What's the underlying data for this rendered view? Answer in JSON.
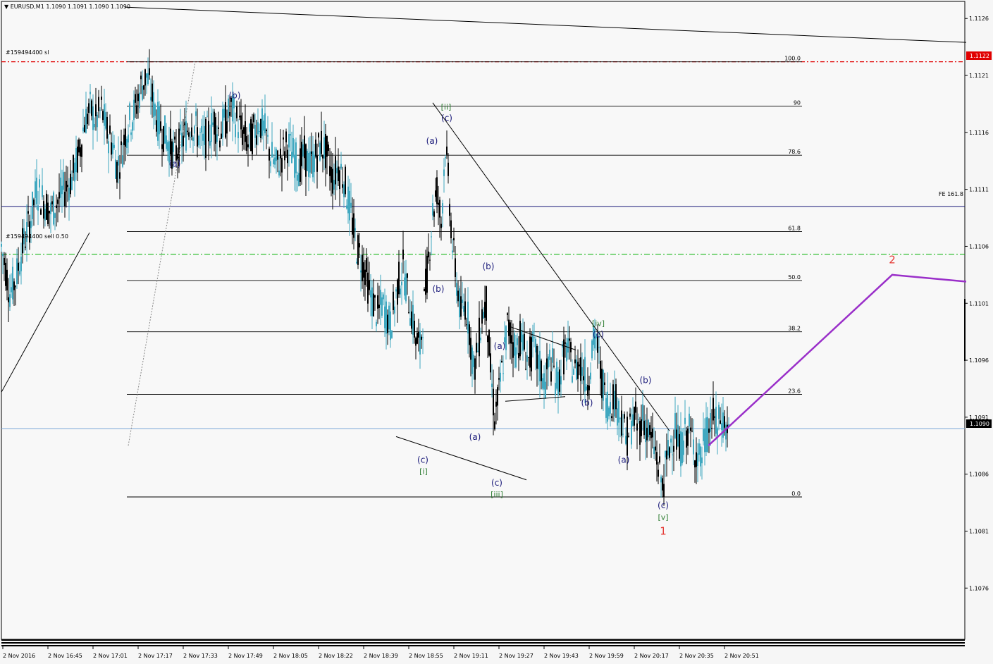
{
  "header": {
    "symbol_text": "EURUSD,M1  1.1090 1.1091 1.1090 1.1090"
  },
  "order_labels": {
    "sl_label": "#159494400 sl",
    "sell_label": "#159494400 sell 0.50"
  },
  "price_tags": {
    "red_tag": "1.1122",
    "current_tag": "1.1090"
  },
  "fe_label": "FE 161.8",
  "colors": {
    "background": "#f6f6f6",
    "bull": "#40a8c0",
    "bear": "#000000",
    "sl_line": "#e00000",
    "sell_line": "#00b000",
    "current_line": "#7da7d9",
    "projection": "#9a2fc9",
    "red_tag_bg": "#e00000",
    "wave_blue": "#1a1a7a",
    "wave_green": "#2e7d32",
    "wave_red": "#e53935"
  },
  "chart_data": {
    "type": "candlestick",
    "symbol": "EURUSD",
    "timeframe": "M1",
    "ylim": [
      1.10715,
      1.11275
    ],
    "y_ticks": [
      "1.1126",
      "1.1121",
      "1.1116",
      "1.1111",
      "1.1106",
      "1.1101",
      "1.1096",
      "1.1091",
      "1.1086",
      "1.1081",
      "1.1076"
    ],
    "x_ticks": [
      "2 Nov 2016",
      "2 Nov 16:45",
      "2 Nov 17:01",
      "2 Nov 17:17",
      "2 Nov 17:33",
      "2 Nov 17:49",
      "2 Nov 18:05",
      "2 Nov 18:22",
      "2 Nov 18:39",
      "2 Nov 18:55",
      "2 Nov 19:11",
      "2 Nov 19:27",
      "2 Nov 19:43",
      "2 Nov 19:59",
      "2 Nov 20:17",
      "2 Nov 20:35",
      "2 Nov 20:51"
    ],
    "price_path": [
      [
        0,
        1.1106
      ],
      [
        6,
        1.1104
      ],
      [
        12,
        1.1102
      ],
      [
        20,
        1.1103
      ],
      [
        30,
        1.1106
      ],
      [
        40,
        1.1108
      ],
      [
        50,
        1.1111
      ],
      [
        60,
        1.111
      ],
      [
        70,
        1.1109
      ],
      [
        80,
        1.111
      ],
      [
        90,
        1.1111
      ],
      [
        100,
        1.1112
      ],
      [
        110,
        1.1114
      ],
      [
        118,
        1.1117
      ],
      [
        126,
        1.1118
      ],
      [
        134,
        1.1117
      ],
      [
        142,
        1.1118
      ],
      [
        150,
        1.1116
      ],
      [
        158,
        1.1115
      ],
      [
        164,
        1.1113
      ],
      [
        170,
        1.1114
      ],
      [
        176,
        1.1116
      ],
      [
        182,
        1.1117
      ],
      [
        190,
        1.1118
      ],
      [
        198,
        1.112
      ],
      [
        206,
        1.1121
      ],
      [
        214,
        1.1119
      ],
      [
        222,
        1.1117
      ],
      [
        230,
        1.1116
      ],
      [
        238,
        1.1115
      ],
      [
        246,
        1.1114
      ],
      [
        254,
        1.1115
      ],
      [
        262,
        1.1116
      ],
      [
        270,
        1.1117
      ],
      [
        278,
        1.1116
      ],
      [
        286,
        1.1115
      ],
      [
        294,
        1.1116
      ],
      [
        302,
        1.1117
      ],
      [
        310,
        1.1116
      ],
      [
        318,
        1.1117
      ],
      [
        326,
        1.1118
      ],
      [
        334,
        1.1117
      ],
      [
        342,
        1.1116
      ],
      [
        350,
        1.1115
      ],
      [
        358,
        1.1116
      ],
      [
        366,
        1.1117
      ],
      [
        374,
        1.1116
      ],
      [
        382,
        1.1114
      ],
      [
        390,
        1.1113
      ],
      [
        398,
        1.1114
      ],
      [
        406,
        1.1115
      ],
      [
        414,
        1.1114
      ],
      [
        422,
        1.1113
      ],
      [
        430,
        1.1114
      ],
      [
        438,
        1.1113
      ],
      [
        446,
        1.1114
      ],
      [
        454,
        1.1115
      ],
      [
        462,
        1.1114
      ],
      [
        470,
        1.1112
      ],
      [
        478,
        1.1113
      ],
      [
        486,
        1.1112
      ],
      [
        492,
        1.111
      ],
      [
        498,
        1.1108
      ],
      [
        504,
        1.1106
      ],
      [
        510,
        1.1105
      ],
      [
        516,
        1.1104
      ],
      [
        522,
        1.1102
      ],
      [
        528,
        1.1101
      ],
      [
        534,
        1.11
      ],
      [
        540,
        1.1101
      ],
      [
        546,
        1.11
      ],
      [
        552,
        1.1099
      ],
      [
        558,
        1.1101
      ],
      [
        564,
        1.1103
      ],
      [
        570,
        1.1104
      ],
      [
        576,
        1.1102
      ],
      [
        582,
        1.11
      ],
      [
        588,
        1.1098
      ],
      [
        594,
        1.1097
      ],
      [
        600,
        1.1101
      ],
      [
        606,
        1.1105
      ],
      [
        612,
        1.1109
      ],
      [
        618,
        1.1111
      ],
      [
        624,
        1.1108
      ],
      [
        630,
        1.1115
      ],
      [
        636,
        1.111
      ],
      [
        640,
        1.1106
      ],
      [
        646,
        1.1103
      ],
      [
        652,
        1.11
      ],
      [
        658,
        1.1101
      ],
      [
        664,
        1.1099
      ],
      [
        670,
        1.1095
      ],
      [
        676,
        1.1097
      ],
      [
        682,
        1.11
      ],
      [
        688,
        1.1101
      ],
      [
        694,
        1.1095
      ],
      [
        700,
        1.1091
      ],
      [
        706,
        1.1093
      ],
      [
        712,
        1.1096
      ],
      [
        718,
        1.1099
      ],
      [
        724,
        1.1098
      ],
      [
        730,
        1.1097
      ],
      [
        736,
        1.1098
      ],
      [
        742,
        1.1097
      ],
      [
        748,
        1.1096
      ],
      [
        754,
        1.1097
      ],
      [
        760,
        1.1096
      ],
      [
        766,
        1.1095
      ],
      [
        772,
        1.1094
      ],
      [
        778,
        1.1096
      ],
      [
        784,
        1.1095
      ],
      [
        790,
        1.1094
      ],
      [
        796,
        1.1096
      ],
      [
        802,
        1.1097
      ],
      [
        808,
        1.1096
      ],
      [
        814,
        1.1095
      ],
      [
        820,
        1.1096
      ],
      [
        826,
        1.1095
      ],
      [
        832,
        1.1094
      ],
      [
        838,
        1.1097
      ],
      [
        844,
        1.1098
      ],
      [
        850,
        1.1095
      ],
      [
        856,
        1.1093
      ],
      [
        862,
        1.1092
      ],
      [
        868,
        1.1093
      ],
      [
        874,
        1.1092
      ],
      [
        880,
        1.1091
      ],
      [
        886,
        1.1089
      ],
      [
        892,
        1.109
      ],
      [
        898,
        1.1091
      ],
      [
        904,
        1.109
      ],
      [
        910,
        1.1091
      ],
      [
        916,
        1.109
      ],
      [
        922,
        1.1089
      ],
      [
        928,
        1.1088
      ],
      [
        934,
        1.1086
      ],
      [
        938,
        1.1085
      ],
      [
        944,
        1.1087
      ],
      [
        950,
        1.1089
      ],
      [
        956,
        1.109
      ],
      [
        962,
        1.1088
      ],
      [
        968,
        1.1089
      ],
      [
        974,
        1.109
      ],
      [
        980,
        1.1089
      ],
      [
        986,
        1.1088
      ],
      [
        992,
        1.1087
      ],
      [
        998,
        1.1089
      ],
      [
        1004,
        1.109
      ],
      [
        1010,
        1.1091
      ],
      [
        1016,
        1.109
      ],
      [
        1022,
        1.1091
      ],
      [
        1028,
        1.109
      ],
      [
        1034,
        1.109
      ]
    ],
    "fibonacci": {
      "levels": [
        {
          "label": "100.0",
          "price": 1.11222
        },
        {
          "label": "90",
          "price": 1.11183
        },
        {
          "label": "78.6",
          "price": 1.1114
        },
        {
          "label": "61.8",
          "price": 1.11073
        },
        {
          "label": "50.0",
          "price": 1.1103
        },
        {
          "label": "38.2",
          "price": 1.10985
        },
        {
          "label": "23.6",
          "price": 1.1093
        },
        {
          "label": "0.0",
          "price": 1.1084
        }
      ]
    },
    "horizontal_lines": {
      "sl_price": 1.11222,
      "sell_price": 1.11053,
      "current_price": 1.109,
      "fe_price": 1.11095
    },
    "wave_labels_blue": [
      {
        "text": "(b)",
        "t": 331,
        "price": 1.1119
      },
      {
        "text": "(a)",
        "t": 246,
        "price": 1.1113
      },
      {
        "text": "(c)",
        "t": 632,
        "price": 1.1117
      },
      {
        "text": "(a)",
        "t": 611,
        "price": 1.1115
      },
      {
        "text": "(b)",
        "t": 691,
        "price": 1.1104
      },
      {
        "text": "(b)",
        "t": 620,
        "price": 1.1102
      },
      {
        "text": "(a)",
        "t": 707,
        "price": 1.1097
      },
      {
        "text": "(c)",
        "t": 847,
        "price": 1.1098
      },
      {
        "text": "(b)",
        "t": 831,
        "price": 1.1092
      },
      {
        "text": "(b)",
        "t": 914,
        "price": 1.1094
      },
      {
        "text": "(a)",
        "t": 672,
        "price": 1.1089
      },
      {
        "text": "(a)",
        "t": 883,
        "price": 1.1087
      },
      {
        "text": "(c)",
        "t": 598,
        "price": 1.1087
      },
      {
        "text": "(c)",
        "t": 703,
        "price": 1.1085
      },
      {
        "text": "(c)",
        "t": 939,
        "price": 1.1083
      }
    ],
    "wave_labels_green": [
      {
        "text": "[ii]",
        "t": 631,
        "price": 1.1118
      },
      {
        "text": "[iv]",
        "t": 847,
        "price": 1.1099
      },
      {
        "text": "[i]",
        "t": 599,
        "price": 1.1086
      },
      {
        "text": "[iii]",
        "t": 703,
        "price": 1.1084
      },
      {
        "text": "[v]",
        "t": 939,
        "price": 1.1082
      }
    ],
    "wave_labels_red": [
      {
        "text": "1",
        "t": 939,
        "price": 1.10807
      },
      {
        "text": "2",
        "t": 1264,
        "price": 1.11045
      }
    ],
    "trendlines": [
      {
        "points": [
          [
            0,
            1.10932
          ],
          [
            125,
            1.11072
          ]
        ]
      },
      {
        "points": [
          [
            612,
            1.11186
          ],
          [
            948,
            1.10898
          ]
        ]
      },
      {
        "points": [
          [
            560,
            1.10893
          ],
          [
            745,
            1.10855
          ]
        ]
      },
      {
        "points": [
          [
            719,
            1.1099
          ],
          [
            815,
            1.10969
          ]
        ]
      },
      {
        "points": [
          [
            715,
            1.10924
          ],
          [
            800,
            1.10928
          ]
        ]
      },
      {
        "points": [
          [
            180,
            1.10885
          ],
          [
            275,
            1.11222
          ]
        ]
      },
      {
        "points": [
          [
            175,
            1.1127
          ],
          [
            1369,
            1.11239
          ]
        ]
      }
    ],
    "projection": {
      "points": [
        [
          1003,
          1.10885
        ],
        [
          1264,
          1.11035
        ],
        [
          1369,
          1.11029
        ]
      ]
    }
  }
}
